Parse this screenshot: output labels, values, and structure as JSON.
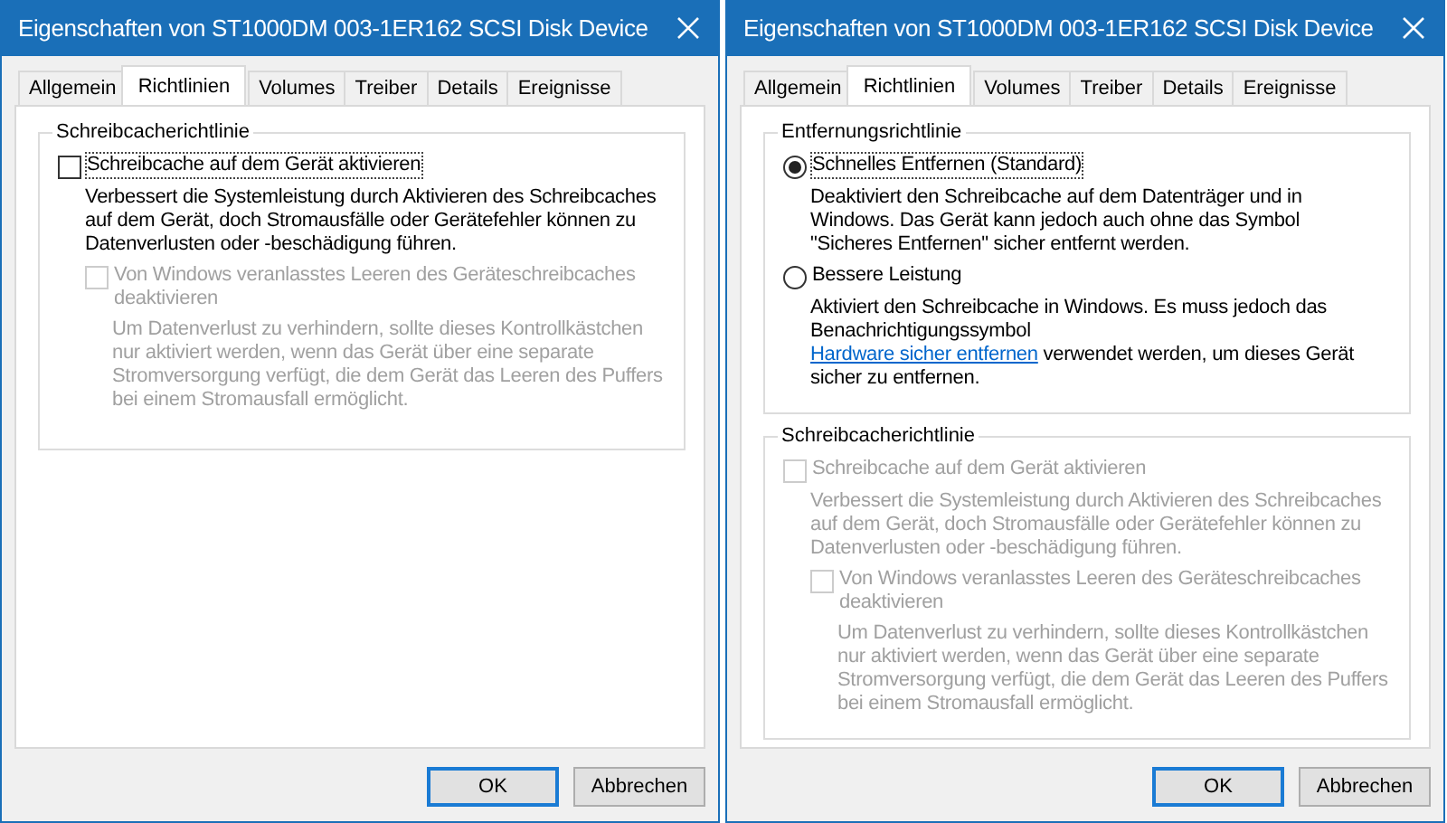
{
  "dialogs": [
    {
      "title": "Eigenschaften von ST1000DM 003-1ER162 SCSI Disk Device",
      "tabs": [
        {
          "label": "Allgemein",
          "selected": false
        },
        {
          "label": "Richtlinien",
          "selected": true
        },
        {
          "label": "Volumes",
          "selected": false
        },
        {
          "label": "Treiber",
          "selected": false
        },
        {
          "label": "Details",
          "selected": false
        },
        {
          "label": "Ereignisse",
          "selected": false
        }
      ],
      "groups": [
        {
          "legend": "Schreibcacherichtlinie",
          "options": [
            {
              "kind": "checkbox",
              "label": "Schreibcache auf dem Gerät aktivieren",
              "checked": false,
              "disabled": false,
              "focused": true,
              "description": "Verbessert die Systemleistung durch Aktivieren des Schreibcaches\nauf dem Gerät, doch Stromausfälle oder Gerätefehler können zu\nDatenverlusten oder -beschädigung führen.",
              "children": [
                {
                  "kind": "checkbox",
                  "label": "Von Windows veranlasstes Leeren des Geräteschreibcaches\ndeaktivieren",
                  "checked": false,
                  "disabled": true,
                  "focused": false,
                  "description": "Um Datenverlust zu verhindern, sollte dieses Kontrollkästchen\nnur aktiviert werden, wenn das Gerät über eine separate\nStromversorgung verfügt, die dem Gerät das Leeren des Puffers\nbei einem Stromausfall ermöglicht."
                }
              ]
            }
          ]
        }
      ],
      "buttons": [
        {
          "label": "OK",
          "default": true
        },
        {
          "label": "Abbrechen",
          "default": false
        }
      ]
    },
    {
      "title": "Eigenschaften von ST1000DM 003-1ER162 SCSI Disk Device",
      "tabs": [
        {
          "label": "Allgemein",
          "selected": false
        },
        {
          "label": "Richtlinien",
          "selected": true
        },
        {
          "label": "Volumes",
          "selected": false
        },
        {
          "label": "Treiber",
          "selected": false
        },
        {
          "label": "Details",
          "selected": false
        },
        {
          "label": "Ereignisse",
          "selected": false
        }
      ],
      "groups": [
        {
          "legend": "Entfernungsrichtlinie",
          "options": [
            {
              "kind": "radio",
              "label": "Schnelles Entfernen (Standard)",
              "selected": true,
              "disabled": false,
              "focused": true,
              "description": "Deaktiviert den Schreibcache auf dem Datenträger und in\nWindows. Das Gerät kann jedoch auch ohne das Symbol\n\"Sicheres Entfernen\" sicher entfernt werden."
            },
            {
              "kind": "radio",
              "label": "Bessere Leistung",
              "selected": false,
              "disabled": false,
              "focused": false,
              "description": "Aktiviert den Schreibcache in Windows. Es muss jedoch das\nBenachrichtigungssymbol",
              "link": "Hardware sicher entfernen",
              "description_after": "verwendet werden, um dieses Gerät\nsicher zu entfernen."
            }
          ]
        },
        {
          "legend": "Schreibcacherichtlinie",
          "options": [
            {
              "kind": "checkbox",
              "label": "Schreibcache auf dem Gerät aktivieren",
              "checked": false,
              "disabled": true,
              "focused": false,
              "description": "Verbessert die Systemleistung durch Aktivieren des Schreibcaches\nauf dem Gerät, doch Stromausfälle oder Gerätefehler können zu\nDatenverlusten oder -beschädigung führen.",
              "children": [
                {
                  "kind": "checkbox",
                  "label": "Von Windows veranlasstes Leeren des Geräteschreibcaches\ndeaktivieren",
                  "checked": false,
                  "disabled": true,
                  "focused": false,
                  "description": "Um Datenverlust zu verhindern, sollte dieses Kontrollkästchen\nnur aktiviert werden, wenn das Gerät über eine separate\nStromversorgung verfügt, die dem Gerät das Leeren des Puffers\nbei einem Stromausfall ermöglicht."
                }
              ]
            }
          ]
        }
      ],
      "buttons": [
        {
          "label": "OK",
          "default": true
        },
        {
          "label": "Abbrechen",
          "default": false
        }
      ]
    }
  ]
}
